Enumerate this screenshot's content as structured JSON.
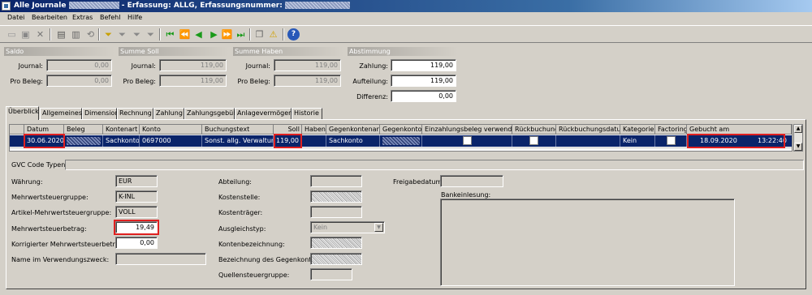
{
  "window": {
    "title_prefix": "Alle Journale",
    "title_mid": " - Erfassung: ALLG, Erfassungsnummer:"
  },
  "menu": [
    "Datei",
    "Bearbeiten",
    "Extras",
    "Befehl",
    "Hilfe"
  ],
  "toolbar_icons": [
    "new-icon",
    "save-icon",
    "delete-icon",
    "print-icon",
    "print-preview-icon",
    "refresh-icon",
    "filter-icon",
    "filter-selection-icon",
    "filter-advanced-icon",
    "remove-filter-icon",
    "first-record-icon",
    "prev-page-icon",
    "prev-record-icon",
    "next-record-icon",
    "next-page-icon",
    "last-record-icon",
    "copy-icon",
    "alert-icon",
    "help-icon"
  ],
  "summary": {
    "saldo": {
      "title": "Saldo",
      "journal_label": "Journal:",
      "journal_value": "0,00",
      "beleg_label": "Pro Beleg:",
      "beleg_value": "0,00"
    },
    "soll": {
      "title": "Summe Soll",
      "journal_label": "Journal:",
      "journal_value": "119,00",
      "beleg_label": "Pro Beleg:",
      "beleg_value": "119,00"
    },
    "haben": {
      "title": "Summe Haben",
      "journal_label": "Journal:",
      "journal_value": "119,00",
      "beleg_label": "Pro Beleg:",
      "beleg_value": "119,00"
    },
    "abstimmung": {
      "title": "Abstimmung",
      "zahlung_label": "Zahlung:",
      "zahlung_value": "119,00",
      "aufteilung_label": "Aufteilung:",
      "aufteilung_value": "119,00",
      "differenz_label": "Differenz:",
      "differenz_value": "0,00"
    }
  },
  "tabs": [
    "Überblick",
    "Allgemeines",
    "Dimension",
    "Rechnung",
    "Zahlung",
    "Zahlungsgebühr",
    "Anlagevermögen",
    "Historie"
  ],
  "grid": {
    "headers": [
      "Datum",
      "Beleg",
      "Kontenart",
      "Konto",
      "Buchungstext",
      "Soll",
      "Haben",
      "Gegenkontenart",
      "Gegenkonto",
      "Einzahlungsbeleg verwenden",
      "Rückbuchung",
      "Rückbuchungsdatum",
      "Kategorie",
      "Factoring",
      "Gebucht am"
    ],
    "row": {
      "datum": "30.06.2020",
      "kontenart": "Sachkonto",
      "konto": "0697000",
      "buchungstext": "Sonst. allg. Verwaltung",
      "soll": "119,00",
      "gegenkontenart": "Sachkonto",
      "kategorie": "Kein",
      "gebucht_datum": "18.09.2020",
      "gebucht_zeit": "13:22:40"
    }
  },
  "details": {
    "gvc_label": "GVC Code Typen:",
    "waehrung_label": "Währung:",
    "waehrung_value": "EUR",
    "mwst_gruppe_label": "Mehrwertsteuergruppe:",
    "mwst_gruppe_value": "K-INL",
    "artikel_mwst_label": "Artikel-Mehrwertsteuergruppe:",
    "artikel_mwst_value": "VOLL",
    "mwst_betrag_label": "Mehrwertsteuerbetrag:",
    "mwst_betrag_value": "19,49",
    "korr_mwst_label": "Korrigierter Mehrwertsteuerbetrag:",
    "korr_mwst_value": "0,00",
    "verwendungszweck_label": "Name im Verwendungszweck:",
    "abteilung_label": "Abteilung:",
    "kostenstelle_label": "Kostenstelle:",
    "kostentraeger_label": "Kostenträger:",
    "ausgleichstyp_label": "Ausgleichstyp:",
    "ausgleichstyp_value": "Kein",
    "kontenbezeichnung_label": "Kontenbezeichnung:",
    "gegenkonto_bez_label": "Bezeichnung des Gegenkontos:",
    "quellensteuer_label": "Quellensteuergruppe:",
    "freigabedatum_label": "Freigabedatum:",
    "bankeinlesung_label": "Bankeinlesung:"
  },
  "colors": {
    "title_bar": "#0a246a",
    "selection": "#0a246a",
    "highlight_box": "#e02020"
  }
}
